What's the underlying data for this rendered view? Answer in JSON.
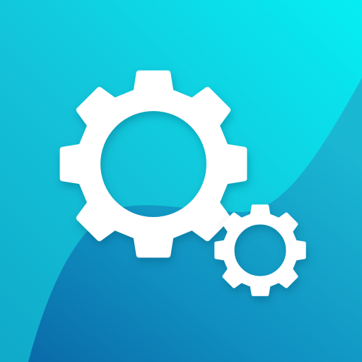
{
  "icon": {
    "semantic": "settings-gears-icon",
    "colors": {
      "background_top_right": "#05e9f0",
      "background_left": "#12b9d2",
      "wave_light": "#1bc4d8",
      "wave_dark": "#0a6fae",
      "gear_fill": "#ffffff",
      "gear_shadow": "#0a5e82"
    },
    "gears": [
      {
        "name": "large-gear-icon",
        "teeth": 8
      },
      {
        "name": "small-gear-icon",
        "teeth": 8
      }
    ]
  }
}
